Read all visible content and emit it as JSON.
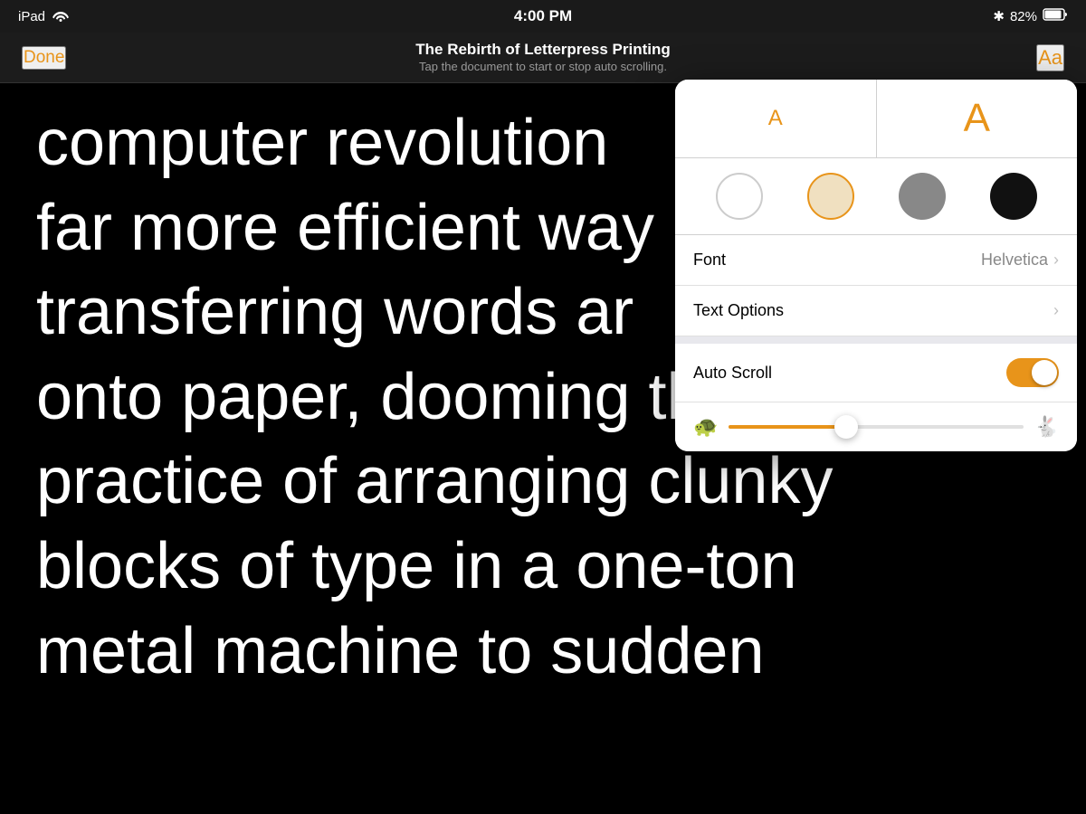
{
  "statusBar": {
    "device": "iPad",
    "time": "4:00 PM",
    "battery": "82%",
    "wifiIcon": "wifi"
  },
  "navBar": {
    "doneLabel": "Done",
    "title": "The Rebirth of Letterpress Printing",
    "subtitle": "Tap the document to start or stop auto scrolling.",
    "aaLabel": "Aa"
  },
  "articleText": [
    "computer revolution",
    "far more efficient way",
    "transferring words ar",
    "onto paper, dooming the old",
    "practice of arranging clunky",
    "blocks of type in a one-ton",
    "metal machine to sudden"
  ],
  "popup": {
    "fontSizeSmallLabel": "A",
    "fontSizeLargeLabel": "A",
    "themes": [
      {
        "id": "white",
        "label": "White theme"
      },
      {
        "id": "sepia",
        "label": "Sepia theme"
      },
      {
        "id": "gray",
        "label": "Gray theme"
      },
      {
        "id": "black",
        "label": "Black theme"
      }
    ],
    "fontRow": {
      "label": "Font",
      "value": "Helvetica",
      "chevron": "›"
    },
    "textOptionsRow": {
      "label": "Text Options",
      "chevron": "›"
    },
    "autoScrollRow": {
      "label": "Auto Scroll",
      "toggleOn": true
    },
    "speedRow": {
      "turtleIcon": "🐢",
      "rabbitIcon": "🐇",
      "sliderPercent": 40
    }
  }
}
